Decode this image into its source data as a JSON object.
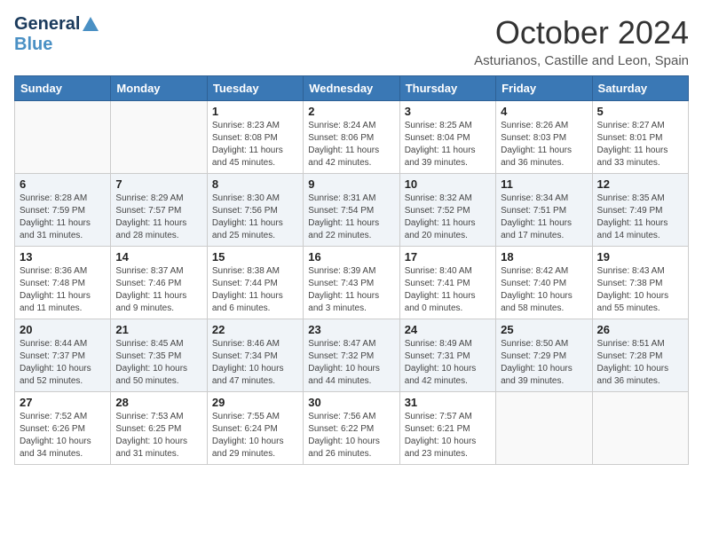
{
  "header": {
    "logo_line1": "General",
    "logo_line2": "Blue",
    "month": "October 2024",
    "location": "Asturianos, Castille and Leon, Spain"
  },
  "days_of_week": [
    "Sunday",
    "Monday",
    "Tuesday",
    "Wednesday",
    "Thursday",
    "Friday",
    "Saturday"
  ],
  "weeks": [
    [
      {
        "day": "",
        "sunrise": "",
        "sunset": "",
        "daylight": ""
      },
      {
        "day": "",
        "sunrise": "",
        "sunset": "",
        "daylight": ""
      },
      {
        "day": "1",
        "sunrise": "Sunrise: 8:23 AM",
        "sunset": "Sunset: 8:08 PM",
        "daylight": "Daylight: 11 hours and 45 minutes."
      },
      {
        "day": "2",
        "sunrise": "Sunrise: 8:24 AM",
        "sunset": "Sunset: 8:06 PM",
        "daylight": "Daylight: 11 hours and 42 minutes."
      },
      {
        "day": "3",
        "sunrise": "Sunrise: 8:25 AM",
        "sunset": "Sunset: 8:04 PM",
        "daylight": "Daylight: 11 hours and 39 minutes."
      },
      {
        "day": "4",
        "sunrise": "Sunrise: 8:26 AM",
        "sunset": "Sunset: 8:03 PM",
        "daylight": "Daylight: 11 hours and 36 minutes."
      },
      {
        "day": "5",
        "sunrise": "Sunrise: 8:27 AM",
        "sunset": "Sunset: 8:01 PM",
        "daylight": "Daylight: 11 hours and 33 minutes."
      }
    ],
    [
      {
        "day": "6",
        "sunrise": "Sunrise: 8:28 AM",
        "sunset": "Sunset: 7:59 PM",
        "daylight": "Daylight: 11 hours and 31 minutes."
      },
      {
        "day": "7",
        "sunrise": "Sunrise: 8:29 AM",
        "sunset": "Sunset: 7:57 PM",
        "daylight": "Daylight: 11 hours and 28 minutes."
      },
      {
        "day": "8",
        "sunrise": "Sunrise: 8:30 AM",
        "sunset": "Sunset: 7:56 PM",
        "daylight": "Daylight: 11 hours and 25 minutes."
      },
      {
        "day": "9",
        "sunrise": "Sunrise: 8:31 AM",
        "sunset": "Sunset: 7:54 PM",
        "daylight": "Daylight: 11 hours and 22 minutes."
      },
      {
        "day": "10",
        "sunrise": "Sunrise: 8:32 AM",
        "sunset": "Sunset: 7:52 PM",
        "daylight": "Daylight: 11 hours and 20 minutes."
      },
      {
        "day": "11",
        "sunrise": "Sunrise: 8:34 AM",
        "sunset": "Sunset: 7:51 PM",
        "daylight": "Daylight: 11 hours and 17 minutes."
      },
      {
        "day": "12",
        "sunrise": "Sunrise: 8:35 AM",
        "sunset": "Sunset: 7:49 PM",
        "daylight": "Daylight: 11 hours and 14 minutes."
      }
    ],
    [
      {
        "day": "13",
        "sunrise": "Sunrise: 8:36 AM",
        "sunset": "Sunset: 7:48 PM",
        "daylight": "Daylight: 11 hours and 11 minutes."
      },
      {
        "day": "14",
        "sunrise": "Sunrise: 8:37 AM",
        "sunset": "Sunset: 7:46 PM",
        "daylight": "Daylight: 11 hours and 9 minutes."
      },
      {
        "day": "15",
        "sunrise": "Sunrise: 8:38 AM",
        "sunset": "Sunset: 7:44 PM",
        "daylight": "Daylight: 11 hours and 6 minutes."
      },
      {
        "day": "16",
        "sunrise": "Sunrise: 8:39 AM",
        "sunset": "Sunset: 7:43 PM",
        "daylight": "Daylight: 11 hours and 3 minutes."
      },
      {
        "day": "17",
        "sunrise": "Sunrise: 8:40 AM",
        "sunset": "Sunset: 7:41 PM",
        "daylight": "Daylight: 11 hours and 0 minutes."
      },
      {
        "day": "18",
        "sunrise": "Sunrise: 8:42 AM",
        "sunset": "Sunset: 7:40 PM",
        "daylight": "Daylight: 10 hours and 58 minutes."
      },
      {
        "day": "19",
        "sunrise": "Sunrise: 8:43 AM",
        "sunset": "Sunset: 7:38 PM",
        "daylight": "Daylight: 10 hours and 55 minutes."
      }
    ],
    [
      {
        "day": "20",
        "sunrise": "Sunrise: 8:44 AM",
        "sunset": "Sunset: 7:37 PM",
        "daylight": "Daylight: 10 hours and 52 minutes."
      },
      {
        "day": "21",
        "sunrise": "Sunrise: 8:45 AM",
        "sunset": "Sunset: 7:35 PM",
        "daylight": "Daylight: 10 hours and 50 minutes."
      },
      {
        "day": "22",
        "sunrise": "Sunrise: 8:46 AM",
        "sunset": "Sunset: 7:34 PM",
        "daylight": "Daylight: 10 hours and 47 minutes."
      },
      {
        "day": "23",
        "sunrise": "Sunrise: 8:47 AM",
        "sunset": "Sunset: 7:32 PM",
        "daylight": "Daylight: 10 hours and 44 minutes."
      },
      {
        "day": "24",
        "sunrise": "Sunrise: 8:49 AM",
        "sunset": "Sunset: 7:31 PM",
        "daylight": "Daylight: 10 hours and 42 minutes."
      },
      {
        "day": "25",
        "sunrise": "Sunrise: 8:50 AM",
        "sunset": "Sunset: 7:29 PM",
        "daylight": "Daylight: 10 hours and 39 minutes."
      },
      {
        "day": "26",
        "sunrise": "Sunrise: 8:51 AM",
        "sunset": "Sunset: 7:28 PM",
        "daylight": "Daylight: 10 hours and 36 minutes."
      }
    ],
    [
      {
        "day": "27",
        "sunrise": "Sunrise: 7:52 AM",
        "sunset": "Sunset: 6:26 PM",
        "daylight": "Daylight: 10 hours and 34 minutes."
      },
      {
        "day": "28",
        "sunrise": "Sunrise: 7:53 AM",
        "sunset": "Sunset: 6:25 PM",
        "daylight": "Daylight: 10 hours and 31 minutes."
      },
      {
        "day": "29",
        "sunrise": "Sunrise: 7:55 AM",
        "sunset": "Sunset: 6:24 PM",
        "daylight": "Daylight: 10 hours and 29 minutes."
      },
      {
        "day": "30",
        "sunrise": "Sunrise: 7:56 AM",
        "sunset": "Sunset: 6:22 PM",
        "daylight": "Daylight: 10 hours and 26 minutes."
      },
      {
        "day": "31",
        "sunrise": "Sunrise: 7:57 AM",
        "sunset": "Sunset: 6:21 PM",
        "daylight": "Daylight: 10 hours and 23 minutes."
      },
      {
        "day": "",
        "sunrise": "",
        "sunset": "",
        "daylight": ""
      },
      {
        "day": "",
        "sunrise": "",
        "sunset": "",
        "daylight": ""
      }
    ]
  ]
}
